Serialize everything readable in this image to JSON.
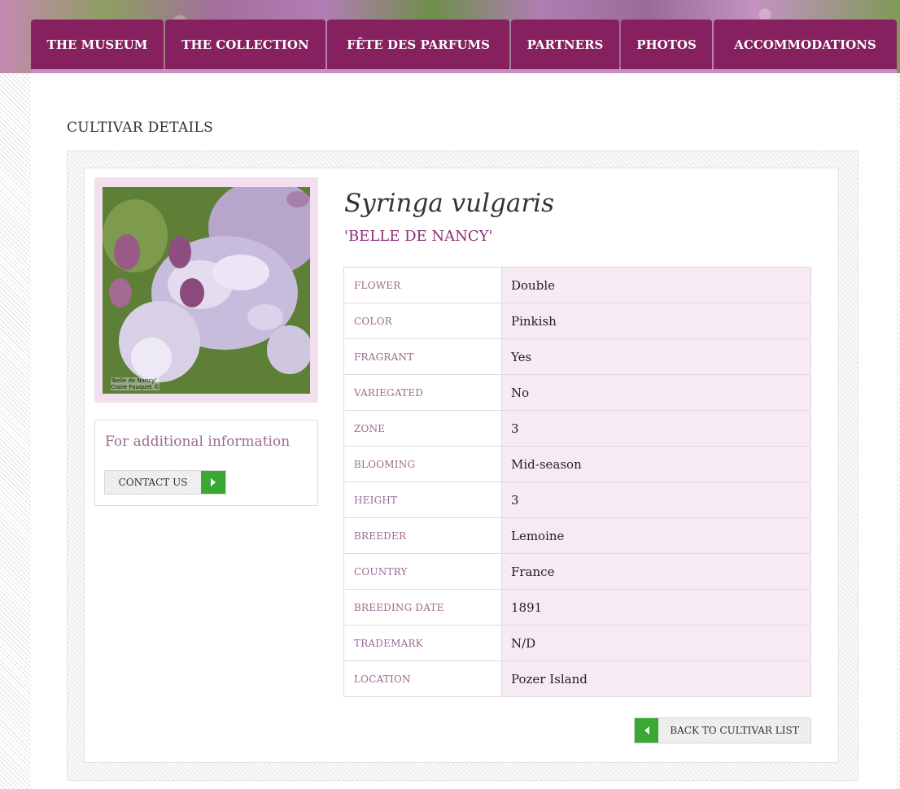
{
  "nav": {
    "items": [
      {
        "label": "THE MUSEUM"
      },
      {
        "label": "THE COLLECTION"
      },
      {
        "label": "FÊTE DES PARFUMS"
      },
      {
        "label": "PARTNERS"
      },
      {
        "label": "PHOTOS"
      },
      {
        "label": "ACCOMMODATIONS"
      }
    ]
  },
  "page_title": "CULTIVAR DETAILS",
  "photo": {
    "caption_line1": "'Belle de Nancy'",
    "caption_line2": "Claire Fouquet ©"
  },
  "sidebar": {
    "info_text": "For additional information",
    "contact_label": "CONTACT US"
  },
  "cultivar": {
    "species": "Syringa vulgaris",
    "name": "'BELLE DE NANCY'"
  },
  "details": [
    {
      "label": "FLOWER",
      "value": "Double"
    },
    {
      "label": "COLOR",
      "value": "Pinkish"
    },
    {
      "label": "FRAGRANT",
      "value": "Yes"
    },
    {
      "label": "VARIEGATED",
      "value": "No"
    },
    {
      "label": "ZONE",
      "value": "3"
    },
    {
      "label": "BLOOMING",
      "value": "Mid-season"
    },
    {
      "label": "HEIGHT",
      "value": "3"
    },
    {
      "label": "BREEDER",
      "value": "Lemoine"
    },
    {
      "label": "COUNTRY",
      "value": "France"
    },
    {
      "label": "BREEDING DATE",
      "value": "1891"
    },
    {
      "label": "TRADEMARK",
      "value": "N/D"
    },
    {
      "label": "LOCATION",
      "value": "Pozer Island"
    }
  ],
  "back_label": "BACK TO CULTIVAR LIST",
  "colors": {
    "nav": "#86205e",
    "accent": "#8b2f75",
    "label": "#9a6a90",
    "row_value_bg": "#f7ebf3",
    "button_green": "#3aa832"
  }
}
